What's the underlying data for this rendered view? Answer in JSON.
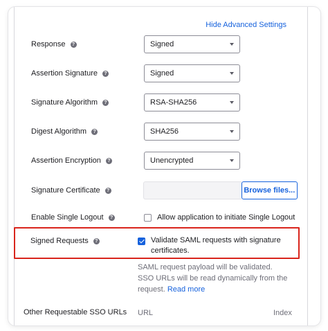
{
  "advanced_link": "Hide Advanced Settings",
  "fields": {
    "response": {
      "label": "Response",
      "value": "Signed"
    },
    "assertion_signature": {
      "label": "Assertion Signature",
      "value": "Signed"
    },
    "signature_algorithm": {
      "label": "Signature Algorithm",
      "value": "RSA-SHA256"
    },
    "digest_algorithm": {
      "label": "Digest Algorithm",
      "value": "SHA256"
    },
    "assertion_encryption": {
      "label": "Assertion Encryption",
      "value": "Unencrypted"
    },
    "signature_certificate": {
      "label": "Signature Certificate",
      "button": "Browse files..."
    },
    "single_logout": {
      "label": "Enable Single Logout",
      "checkbox_label": "Allow application to initiate Single Logout",
      "checked": false
    },
    "signed_requests": {
      "label": "Signed Requests",
      "checkbox_label": "Validate SAML requests with signature certificates.",
      "checked": true
    },
    "signed_requests_help": "SAML request payload will be validated. SSO URLs will be read dynamically from the request.",
    "read_more": "Read more",
    "sso_urls": {
      "label": "Other Requestable SSO URLs",
      "col_url": "URL",
      "col_index": "Index"
    }
  },
  "colors": {
    "accent": "#1662dd",
    "highlight": "#d9251c",
    "muted": "#6e6e78"
  }
}
